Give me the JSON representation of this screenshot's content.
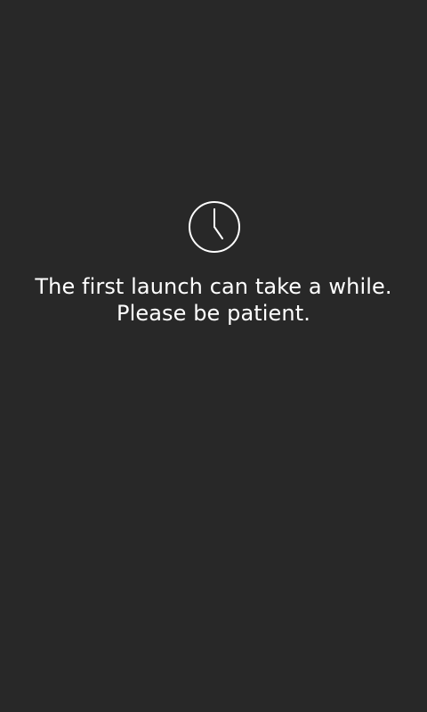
{
  "loading_screen": {
    "icon": "clock-icon",
    "message_lines": [
      "The first launch can take a while.",
      "Please be patient."
    ],
    "background_color": "#282828",
    "text_color": "#ffffff"
  }
}
